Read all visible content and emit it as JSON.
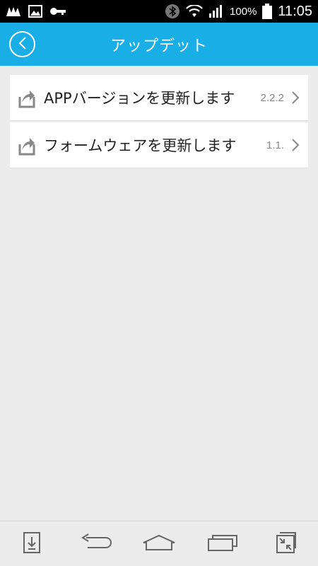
{
  "status_bar": {
    "battery_percent": "100%",
    "time": "11:05",
    "left_icons": [
      "app-notification-icon",
      "image-icon",
      "key-icon"
    ],
    "right_icons": [
      "bluetooth-icon",
      "wifi-icon",
      "signal-icon",
      "battery-icon"
    ]
  },
  "header": {
    "title": "アップデット",
    "back_icon": "back-chevron-icon",
    "color": "#19aee6"
  },
  "list": {
    "items": [
      {
        "label": "APPバージョンを更新します",
        "value": "2.2.2",
        "icon": "upload-icon"
      },
      {
        "label": "フォームウェアを更新します",
        "value": "1.1.",
        "icon": "upload-icon"
      }
    ]
  },
  "nav_bar": {
    "buttons": [
      "download-icon",
      "back-icon",
      "home-icon",
      "recent-apps-icon",
      "shrink-icon"
    ]
  }
}
